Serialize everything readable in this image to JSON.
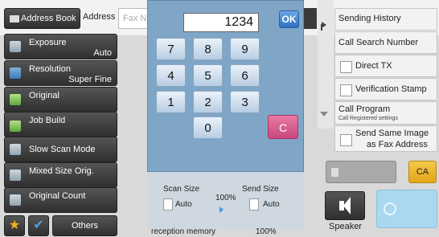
{
  "top": {
    "address_book": "Address Book",
    "address_label": "Address",
    "fax_placeholder": "Fax N"
  },
  "left_menu": [
    {
      "label": "Exposure",
      "value": "Auto"
    },
    {
      "label": "Resolution",
      "value": "Super Fine"
    },
    {
      "label": "Original",
      "value": ""
    },
    {
      "label": "Job Build",
      "value": ""
    },
    {
      "label": "Slow Scan Mode",
      "value": ""
    },
    {
      "label": "Mixed Size Orig.",
      "value": ""
    },
    {
      "label": "Original Count",
      "value": ""
    }
  ],
  "bottom_left": {
    "others": "Others"
  },
  "keypad": {
    "display": "1234",
    "ok": "OK",
    "keys": [
      "7",
      "8",
      "9",
      "4",
      "5",
      "6",
      "1",
      "2",
      "3",
      "0"
    ],
    "clear": "C"
  },
  "scan": {
    "scan_size_label": "Scan Size",
    "scan_size_value": "Auto",
    "ratio": "100%",
    "send_size_label": "Send Size",
    "send_size_value": "Auto",
    "memory_label": "reception memory",
    "memory_value": "100%"
  },
  "right_menu": {
    "sending_history": "Sending History",
    "call_search_number": "Call Search Number",
    "direct_tx": "Direct TX",
    "verification_stamp": "Verification Stamp",
    "call_program": "Call Program",
    "call_program_sub": "Call Registered settings",
    "send_same_image_1": "Send Same Image",
    "send_same_image_2": "as Fax Address"
  },
  "actions": {
    "ca": "CA",
    "speaker": "Speaker"
  },
  "colors": {
    "panel_blue": "#7fa6c7",
    "clear_pink": "#d9598c",
    "ca_yellow": "#edb82b",
    "ok_blue": "#3f82d3"
  }
}
